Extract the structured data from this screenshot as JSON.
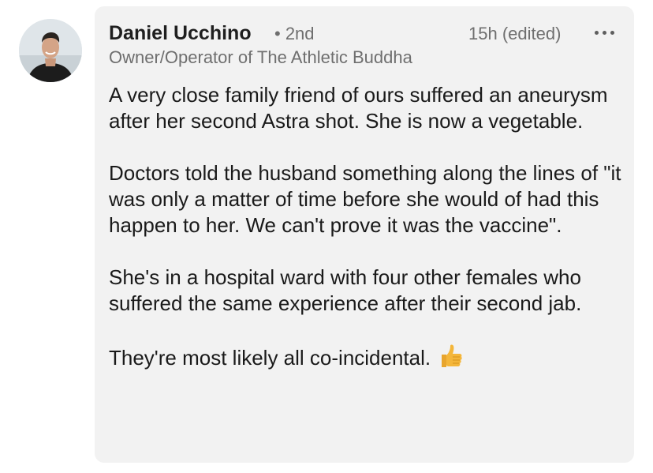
{
  "comment": {
    "author": {
      "name": "Daniel Ucchino",
      "degree": "• 2nd",
      "headline": "Owner/Operator of The Athletic Buddha"
    },
    "timestamp": "15h (edited)",
    "more_label": "•••",
    "paragraphs": [
      "A very close family friend of ours suffered an aneurysm after her second Astra shot. She is now a vegetable.",
      "Doctors told the husband something along the lines of \"it was only a matter of time before she would of had this happen to her. We can't prove it was the vaccine\".",
      "She's in a hospital ward with four other females who suffered the same experience after their second jab.",
      "They're most likely all co-incidental."
    ],
    "trailing_emoji": "thumbs-up-icon"
  },
  "colors": {
    "bubble_background": "#f2f2f2",
    "secondary_text": "#6f6f6f",
    "primary_text": "#1a1a1a",
    "emoji": "#f4b63a"
  }
}
